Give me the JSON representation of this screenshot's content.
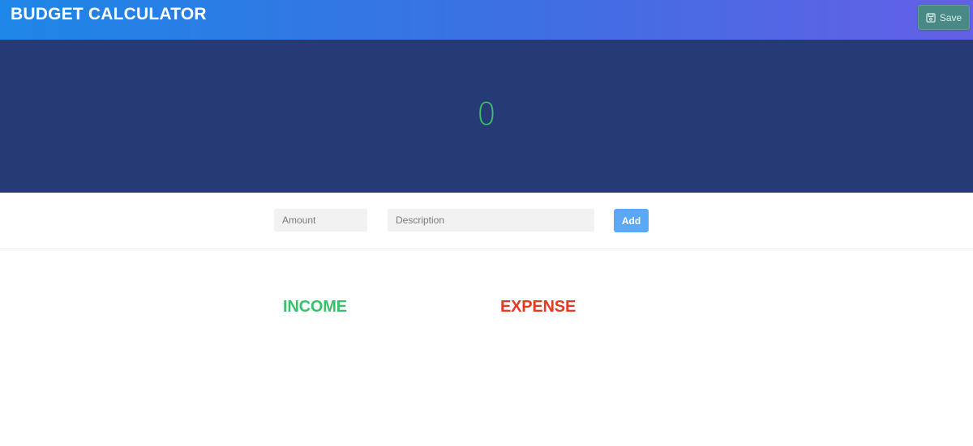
{
  "header": {
    "title": "BUDGET CALCULATOR",
    "save_label": "Save",
    "save_icon": "floppy-disk-icon"
  },
  "balance": {
    "value": "0"
  },
  "form": {
    "amount_placeholder": "Amount",
    "description_placeholder": "Description",
    "add_label": "Add"
  },
  "sections": {
    "income_title": "INCOME",
    "expense_title": "EXPENSE"
  },
  "colors": {
    "header_gradient_start": "#1e86e6",
    "header_gradient_end": "#6460e6",
    "balance_bg": "#263a75",
    "balance_text": "#3fbf6a",
    "save_button": "#4a8a86",
    "add_button": "#59a9f6",
    "income": "#35c26b",
    "expense": "#e53a1f"
  }
}
